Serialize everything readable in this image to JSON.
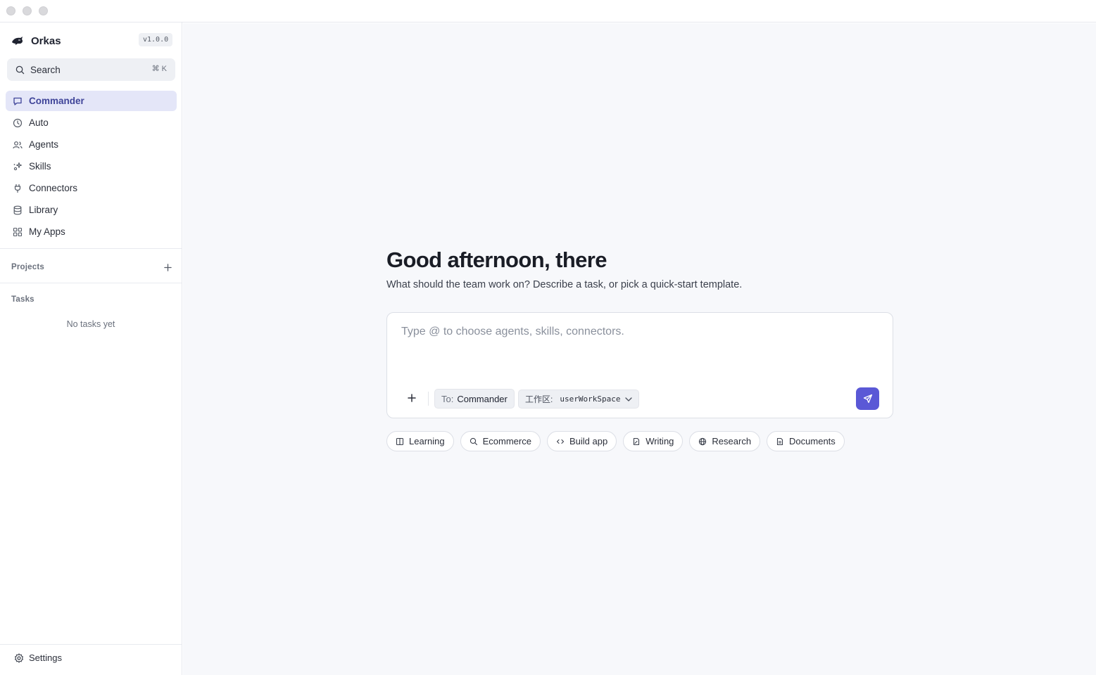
{
  "app": {
    "name": "Orkas",
    "version": "v1.0.0"
  },
  "search": {
    "label": "Search",
    "shortcut": "⌘ K"
  },
  "nav": {
    "items": [
      {
        "label": "Commander",
        "icon": "chat-bubble-icon",
        "active": true
      },
      {
        "label": "Auto",
        "icon": "clock-icon"
      },
      {
        "label": "Agents",
        "icon": "users-icon"
      },
      {
        "label": "Skills",
        "icon": "sparkles-icon"
      },
      {
        "label": "Connectors",
        "icon": "plug-icon"
      },
      {
        "label": "Library",
        "icon": "database-icon"
      },
      {
        "label": "My Apps",
        "icon": "grid-icon"
      }
    ]
  },
  "projects": {
    "label": "Projects"
  },
  "tasks": {
    "label": "Tasks",
    "empty": "No tasks yet"
  },
  "settings": {
    "label": "Settings"
  },
  "main": {
    "greeting": "Good afternoon, there",
    "subtitle": "What should the team work on? Describe a task, or pick a quick-start template."
  },
  "composer": {
    "placeholder": "Type @ to choose agents, skills, connectors.",
    "value": "",
    "to_prefix": "To:",
    "to_value": "Commander",
    "workspace_prefix": "工作区:",
    "workspace_value": "userWorkSpace"
  },
  "templates": [
    {
      "label": "Learning",
      "icon": "book-icon"
    },
    {
      "label": "Ecommerce",
      "icon": "search-icon"
    },
    {
      "label": "Build app",
      "icon": "code-icon"
    },
    {
      "label": "Writing",
      "icon": "pen-file-icon"
    },
    {
      "label": "Research",
      "icon": "globe-icon"
    },
    {
      "label": "Documents",
      "icon": "file-icon"
    }
  ],
  "colors": {
    "accent": "#5a58d6",
    "active_bg": "#e4e6f8",
    "active_text": "#3f4499"
  }
}
